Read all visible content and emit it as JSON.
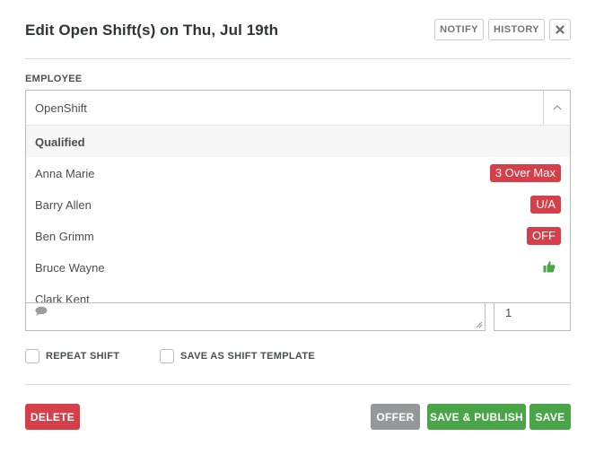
{
  "modal": {
    "title": "Edit Open Shift(s) on Thu, Jul 19th",
    "notify_label": "NOTIFY",
    "history_label": "HISTORY",
    "close_icon": "close-icon"
  },
  "employee": {
    "label": "EMPLOYEE",
    "selected": "OpenShift",
    "dropdown": {
      "group_label": "Qualified",
      "items": [
        {
          "name": "Anna Marie",
          "badge": "3 Over Max",
          "badge_color": "#d43f4a"
        },
        {
          "name": "Barry Allen",
          "badge": "U/A",
          "badge_color": "#d43f4a"
        },
        {
          "name": "Ben Grimm",
          "badge": "OFF",
          "badge_color": "#d43f4a"
        },
        {
          "name": "Bruce Wayne",
          "icon": "thumbs-up-icon",
          "icon_color": "#4aa549"
        },
        {
          "name": "Clark Kent"
        }
      ]
    }
  },
  "notes": {
    "icon": "comment-icon"
  },
  "quantity": {
    "value": "1"
  },
  "options": {
    "repeat_shift": "REPEAT SHIFT",
    "save_as_template": "SAVE AS SHIFT TEMPLATE"
  },
  "actions": {
    "delete": "DELETE",
    "offer": "OFFER",
    "save_publish": "SAVE & PUBLISH",
    "save": "SAVE"
  },
  "colors": {
    "danger": "#d43f4a",
    "success": "#4aa549",
    "neutral": "#959899"
  }
}
